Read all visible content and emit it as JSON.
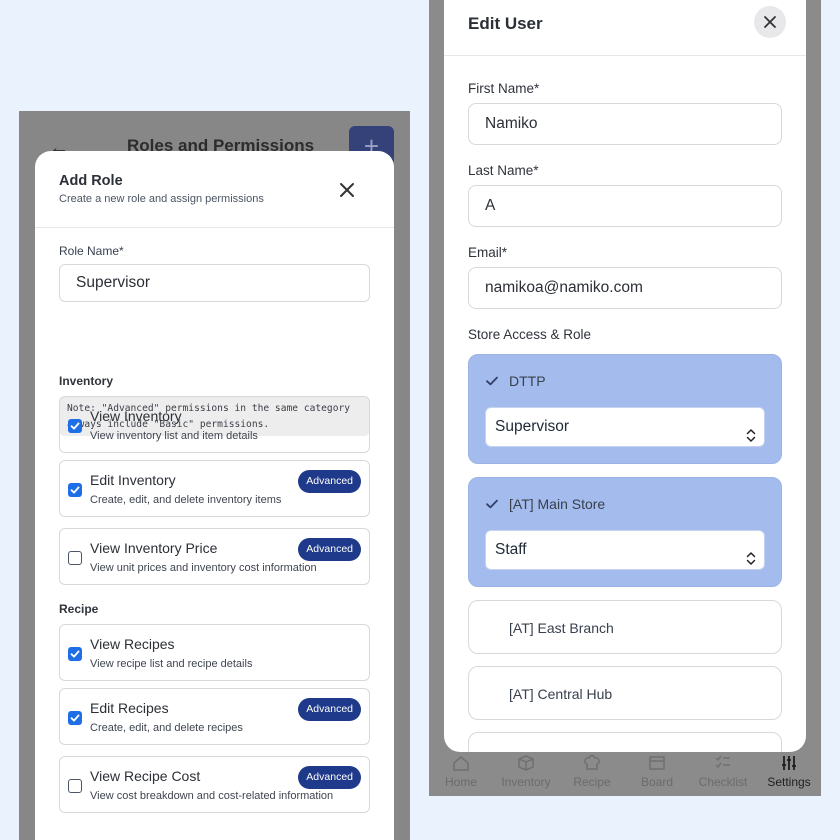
{
  "left": {
    "background": {
      "title": "Roles and Permissions",
      "back_icon": "arrow-left-icon",
      "add_icon": "plus-icon"
    },
    "modal": {
      "title": "Add Role",
      "subtitle": "Create a new role and assign permissions",
      "role_name_label": "Role Name*",
      "role_name_value": "Supervisor",
      "note": "Note: \"Advanced\" permissions in the same category always include \"Basic\" permissions.",
      "sections": [
        {
          "title": "Inventory",
          "permissions": [
            {
              "name": "View Inventory",
              "desc": "View inventory list and item details",
              "checked": true,
              "badge": ""
            },
            {
              "name": "Edit Inventory",
              "desc": "Create, edit, and delete inventory items",
              "checked": true,
              "badge": "Advanced"
            },
            {
              "name": "View Inventory Price",
              "desc": "View unit prices and inventory cost information",
              "checked": false,
              "badge": "Advanced"
            }
          ]
        },
        {
          "title": "Recipe",
          "permissions": [
            {
              "name": "View Recipes",
              "desc": "View recipe list and recipe details",
              "checked": true,
              "badge": ""
            },
            {
              "name": "Edit Recipes",
              "desc": "Create, edit, and delete recipes",
              "checked": true,
              "badge": "Advanced"
            },
            {
              "name": "View Recipe Cost",
              "desc": "View cost breakdown and cost-related information",
              "checked": false,
              "badge": "Advanced"
            }
          ]
        }
      ]
    }
  },
  "right": {
    "modal": {
      "title": "Edit User",
      "first_name_label": "First Name*",
      "first_name_value": "Namiko",
      "last_name_label": "Last Name*",
      "last_name_value": "A",
      "email_label": "Email*",
      "email_value": "namikoa@namiko.com",
      "store_access_label": "Store Access & Role",
      "stores": [
        {
          "name": "DTTP",
          "selected": true,
          "role": "Supervisor"
        },
        {
          "name": "[AT] Main Store",
          "selected": true,
          "role": "Staff"
        },
        {
          "name": "[AT] East Branch",
          "selected": false,
          "role": ""
        },
        {
          "name": "[AT] Central Hub",
          "selected": false,
          "role": ""
        }
      ]
    },
    "tabbar": [
      {
        "label": "Home",
        "icon": "home-icon",
        "active": false
      },
      {
        "label": "Inventory",
        "icon": "box-icon",
        "active": false
      },
      {
        "label": "Recipe",
        "icon": "chef-hat-icon",
        "active": false
      },
      {
        "label": "Board",
        "icon": "board-icon",
        "active": false
      },
      {
        "label": "Checklist",
        "icon": "checklist-icon",
        "active": false
      },
      {
        "label": "Settings",
        "icon": "sliders-icon",
        "active": true
      }
    ]
  },
  "colors": {
    "page_bg": "#eaf2fd",
    "badge": "#1f3a8a",
    "checkbox": "#1e6fe6",
    "store_selected": "#a3bbed"
  }
}
